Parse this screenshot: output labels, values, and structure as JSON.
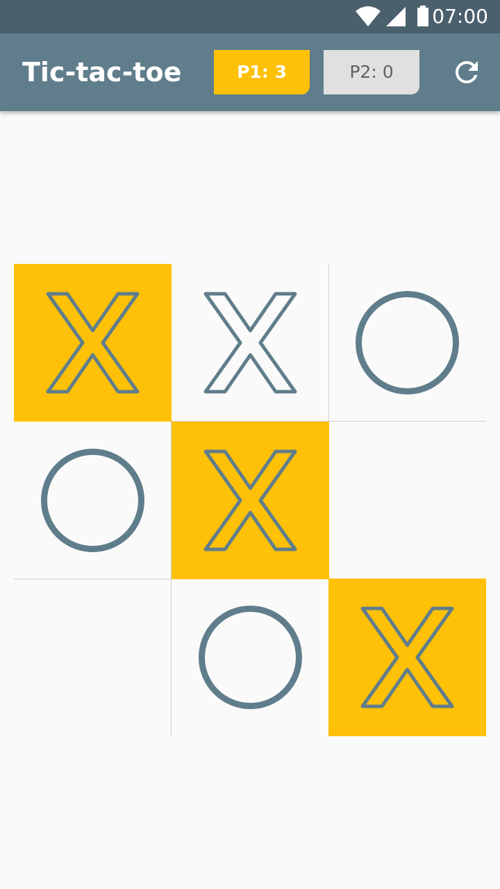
{
  "status_bar": {
    "time": "07:00",
    "icons": [
      "wifi-icon",
      "cell-signal-icon",
      "battery-icon"
    ]
  },
  "app_bar": {
    "title": "Tic-tac-toe",
    "player1_score_label": "P1: 3",
    "player2_score_label": "P2: 0",
    "refresh_icon": "refresh-icon"
  },
  "colors": {
    "status_bar": "#4b606d",
    "app_bar": "#607d8b",
    "accent": "#ffc107",
    "mark": "#607d8b",
    "inactive_chip": "#e0e0e0",
    "background": "#fafafa"
  },
  "board": {
    "cells": [
      {
        "mark": "X",
        "win": true
      },
      {
        "mark": "X",
        "win": false
      },
      {
        "mark": "O",
        "win": false
      },
      {
        "mark": "O",
        "win": false
      },
      {
        "mark": "X",
        "win": true
      },
      {
        "mark": "",
        "win": false
      },
      {
        "mark": "",
        "win": false
      },
      {
        "mark": "O",
        "win": false
      },
      {
        "mark": "X",
        "win": true
      }
    ]
  }
}
